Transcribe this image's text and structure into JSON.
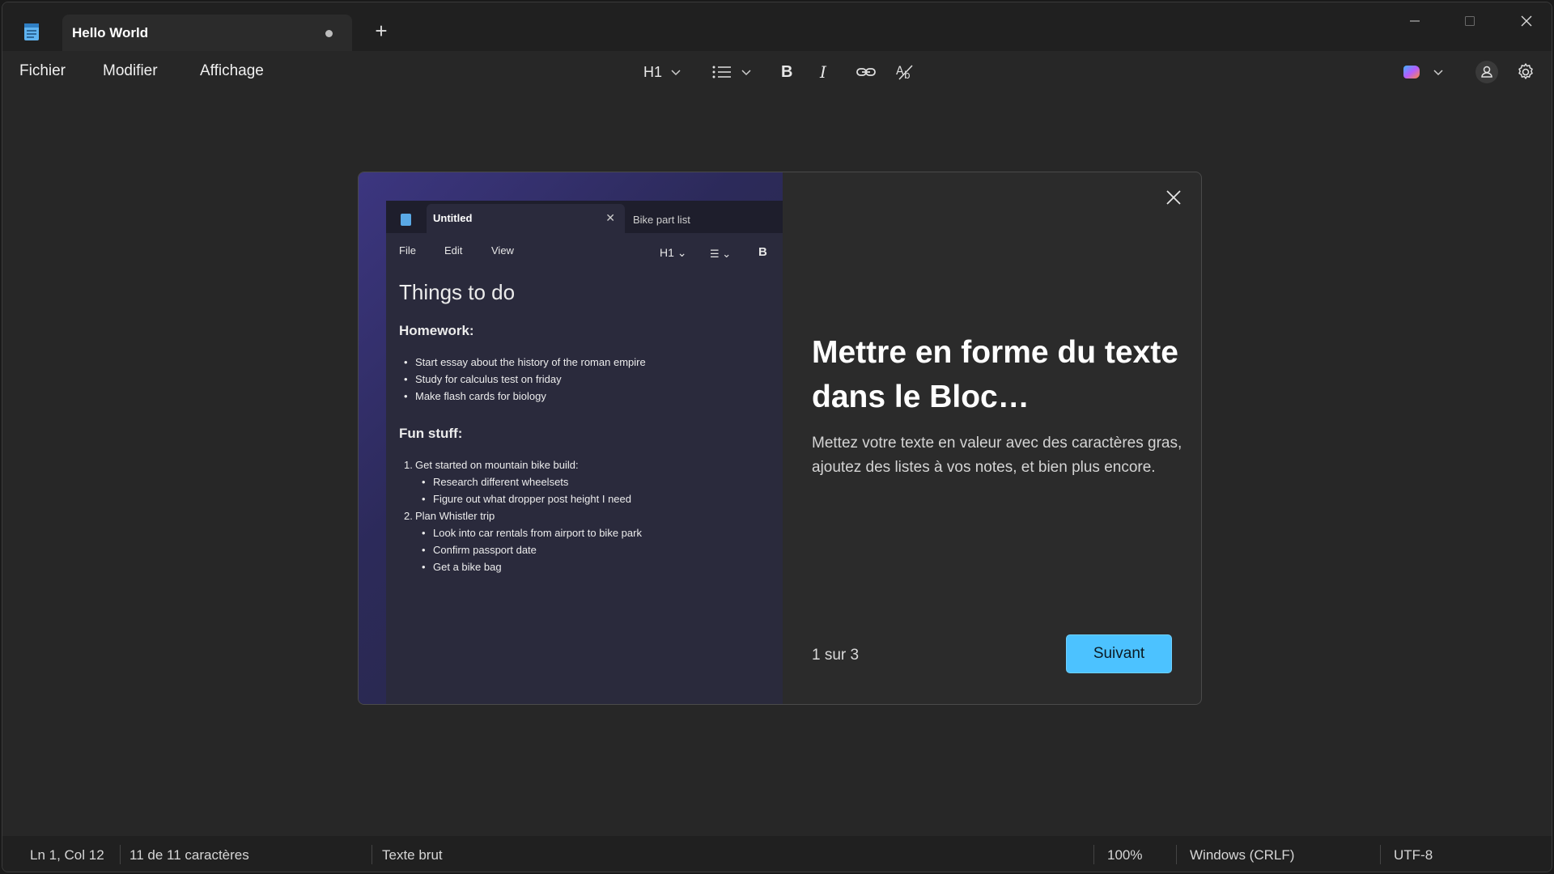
{
  "window": {
    "tab_title": "Hello World",
    "new_tab_label": "+"
  },
  "menu": {
    "file": "Fichier",
    "edit": "Modifier",
    "view": "Affichage"
  },
  "toolbar": {
    "heading": "H1",
    "bold": "B",
    "italic": "I"
  },
  "dialog": {
    "heading": "Mettre en forme du texte dans le Bloc…",
    "description": "Mettez votre texte en valeur avec des caractères gras, ajoutez des listes à vos notes, et bien plus encore.",
    "page_indicator": "1 sur 3",
    "next_button": "Suivant",
    "preview": {
      "tab_title": "Untitled",
      "tab2_title": "Bike part list",
      "menu": [
        "File",
        "Edit",
        "View"
      ],
      "heading": "H1",
      "bold": "B",
      "doc_title": "Things to do",
      "section1": "Homework:",
      "homework": [
        "Start essay about the history of the roman empire",
        "Study for calculus test on friday",
        "Make flash cards for biology"
      ],
      "section2": "Fun stuff:",
      "fun": [
        {
          "num": "1.",
          "text": "Get started on mountain bike build:",
          "subs": [
            "Research different wheelsets",
            "Figure out what dropper post height I need"
          ]
        },
        {
          "num": "2.",
          "text": "Plan Whistler trip",
          "subs": [
            "Look into car rentals from airport to bike park",
            "Confirm passport date",
            "Get a bike bag"
          ]
        }
      ]
    }
  },
  "status": {
    "position": "Ln 1, Col 12",
    "chars": "11 de 11 caractères",
    "type": "Texte brut",
    "zoom": "100%",
    "eol": "Windows (CRLF)",
    "encoding": "UTF-8"
  },
  "colors": {
    "accent": "#4cc2ff",
    "background": "#272727"
  }
}
